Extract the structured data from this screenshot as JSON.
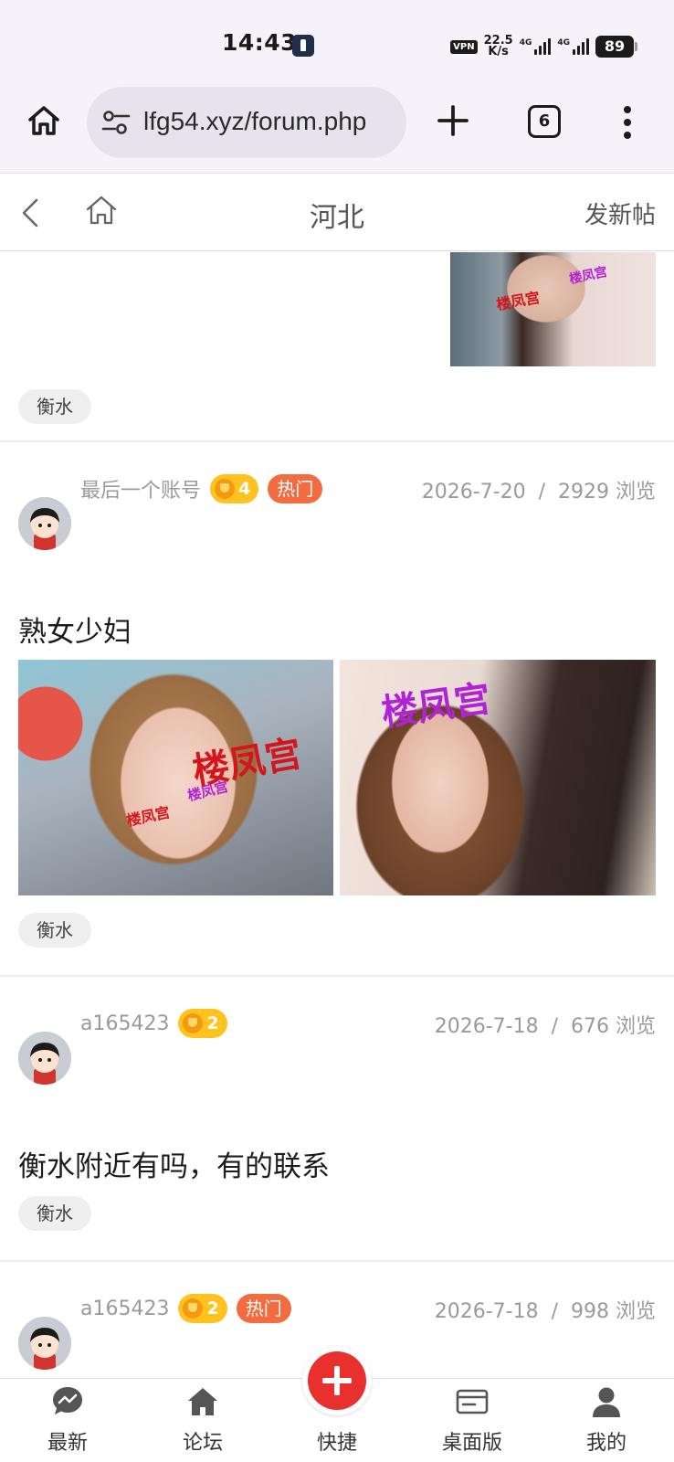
{
  "status_bar": {
    "time": "14:43",
    "vpn": "VPN",
    "speed_value": "22.5",
    "speed_unit": "K/s",
    "net1": "4G",
    "net2": "4G",
    "battery": "89"
  },
  "browser": {
    "url": "lfg54.xyz/forum.php",
    "tab_count": "6"
  },
  "forum_header": {
    "title": "河北",
    "new_post": "发新帖"
  },
  "posts": [
    {
      "tag": "衡水"
    },
    {
      "author": "最后一个账号",
      "level": "4",
      "hot": "热门",
      "date": "2026-7-20",
      "views": "2929 浏览",
      "title": "熟女少妇",
      "tag": "衡水",
      "watermark": "楼凤宫"
    },
    {
      "author": "a165423",
      "level": "2",
      "date": "2026-7-18",
      "views": "676 浏览",
      "title": "衡水附近有吗，有的联系",
      "tag": "衡水"
    },
    {
      "author": "a165423",
      "level": "2",
      "hot": "热门",
      "date": "2026-7-18",
      "views": "998 浏览"
    }
  ],
  "bottom_nav": [
    {
      "label": "最新",
      "icon": "latest-icon"
    },
    {
      "label": "论坛",
      "icon": "forum-home-icon"
    },
    {
      "label": "快捷",
      "icon": "plus-icon"
    },
    {
      "label": "桌面版",
      "icon": "desktop-icon"
    },
    {
      "label": "我的",
      "icon": "user-icon"
    }
  ]
}
